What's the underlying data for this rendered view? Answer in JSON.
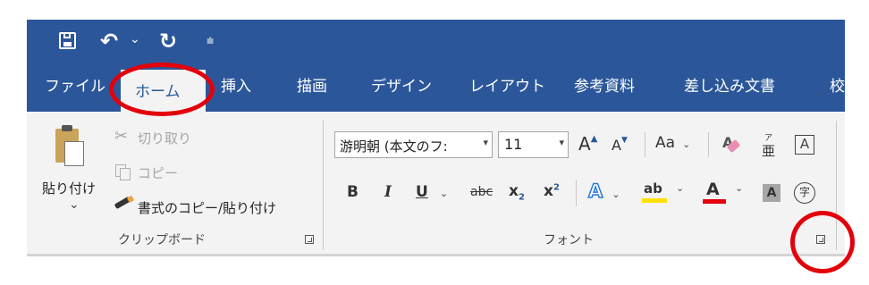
{
  "quick_access": {
    "undo_dropdown": "⌄",
    "customize": "⩧"
  },
  "tabs": [
    "ファイル",
    "ホーム",
    "挿入",
    "描画",
    "デザイン",
    "レイアウト",
    "参考資料",
    "差し込み文書",
    "校"
  ],
  "clipboard": {
    "paste": "貼り付け",
    "paste_dropdown": "⌄",
    "cut": "切り取り",
    "copy": "コピー",
    "format_painter": "書式のコピー/貼り付け",
    "group_label": "クリップボード"
  },
  "font": {
    "font_name": "游明朝 (本文のフ:",
    "font_size": "11",
    "change_case": "Aa",
    "bold": "B",
    "italic": "I",
    "underline": "U",
    "strikethrough": "abc",
    "subscript_base": "x",
    "subscript": "2",
    "superscript_base": "x",
    "superscript": "2",
    "highlight": "ab",
    "font_color": "A",
    "enclose": "字",
    "phonetic_top": "ア",
    "phonetic_base": "亜",
    "group_label": "フォント"
  },
  "colors": {
    "accent": "#2b579a",
    "annotation": "#e3000b",
    "highlight_yellow": "#ffe000",
    "font_red": "#e3000b"
  }
}
